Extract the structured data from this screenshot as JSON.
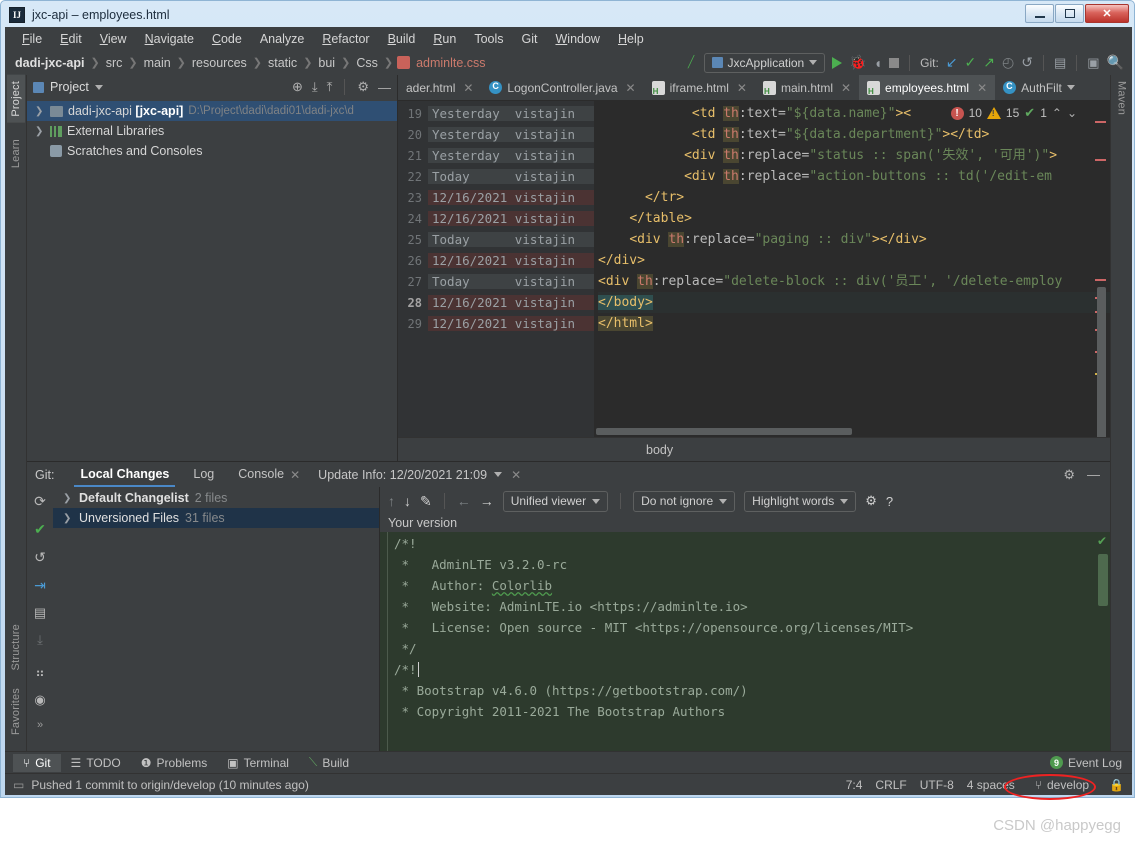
{
  "window": {
    "title": "jxc-api – employees.html",
    "app_icon": "IJ",
    "controls": {
      "minimize": "minimize-icon",
      "maximize": "maximize-icon",
      "close": "✕"
    }
  },
  "menu": {
    "items": [
      "File",
      "Edit",
      "View",
      "Navigate",
      "Code",
      "Analyze",
      "Refactor",
      "Build",
      "Run",
      "Tools",
      "Git",
      "Window",
      "Help"
    ]
  },
  "navbar": {
    "crumbs": [
      "dadi-jxc-api",
      "src",
      "main",
      "resources",
      "static",
      "bui",
      "Css",
      "adminlte.css"
    ],
    "run_config": "JxcApplication",
    "git_label": "Git:"
  },
  "project": {
    "title": "Project",
    "tree": [
      {
        "arrow": ">",
        "name": "dadi-jxc-api",
        "module": "[jxc-api]",
        "path": "D:\\Project\\dadi\\dadi01\\dadi-jxc\\d",
        "selected": true
      },
      {
        "arrow": ">",
        "name": "External Libraries",
        "module": "",
        "path": "",
        "selected": false
      },
      {
        "arrow": "",
        "name": "Scratches and Consoles",
        "module": "",
        "path": "",
        "selected": false
      }
    ]
  },
  "editor": {
    "tabs": [
      {
        "label": "ader.html",
        "type": "html",
        "active": false
      },
      {
        "label": "LogonController.java",
        "type": "java",
        "active": false
      },
      {
        "label": "iframe.html",
        "type": "html",
        "active": false
      },
      {
        "label": "main.html",
        "type": "html",
        "active": false
      },
      {
        "label": "employees.html",
        "type": "html",
        "active": true
      },
      {
        "label": "AuthFilt",
        "type": "java",
        "active": false
      }
    ],
    "annotate": [
      {
        "num": "19",
        "date": "Yesterday",
        "author": "vistajin",
        "shade": "gray"
      },
      {
        "num": "20",
        "date": "Yesterday",
        "author": "vistajin",
        "shade": "gray"
      },
      {
        "num": "21",
        "date": "Yesterday",
        "author": "vistajin",
        "shade": "gray"
      },
      {
        "num": "22",
        "date": "Today",
        "author": "vistajin",
        "shade": "gray"
      },
      {
        "num": "23",
        "date": "12/16/2021",
        "author": "vistajin",
        "shade": "red"
      },
      {
        "num": "24",
        "date": "12/16/2021",
        "author": "vistajin",
        "shade": "red"
      },
      {
        "num": "25",
        "date": "Today",
        "author": "vistajin",
        "shade": "gray"
      },
      {
        "num": "26",
        "date": "12/16/2021",
        "author": "vistajin",
        "shade": "red"
      },
      {
        "num": "27",
        "date": "Today",
        "author": "vistajin",
        "shade": "gray"
      },
      {
        "num": "28",
        "date": "12/16/2021",
        "author": "vistajin",
        "shade": "red",
        "current": true
      },
      {
        "num": "29",
        "date": "12/16/2021",
        "author": "vistajin",
        "shade": "red"
      }
    ],
    "code_lines": [
      "            <td th:text=\"${data.name}\"><",
      "            <td th:text=\"${data.department}\"></td>",
      "           <div th:replace=\"status :: span('失效', '可用')\">",
      "           <div th:replace=\"action-buttons :: td('/edit-em",
      "      </tr>",
      "    </table>",
      "    <div th:replace=\"paging :: div\"></div>",
      "</div>",
      "<div th:replace=\"delete-block :: div('员工', '/delete-employ",
      "</body>",
      "</html>"
    ],
    "inspection": {
      "errors": "10",
      "warnings": "15",
      "checks": "1"
    },
    "breadcrumb": "body"
  },
  "git_tool": {
    "label": "Git:",
    "tabs": [
      "Local Changes",
      "Log",
      "Console"
    ],
    "active_tab": "Local Changes",
    "update_info": "Update Info: 12/20/2021 21:09",
    "changelists": [
      {
        "name": "Default Changelist",
        "count": "2 files",
        "selected": false
      },
      {
        "name": "Unversioned Files",
        "count": "31 files",
        "selected": true
      }
    ],
    "diff_toolbar": {
      "viewer": "Unified viewer",
      "ignore": "Do not ignore",
      "highlight": "Highlight words",
      "help": "?"
    },
    "your_version": "Your version",
    "diff_lines": [
      "/*!",
      " *   AdminLTE v3.2.0-rc",
      " *   Author: Colorlib",
      " *   Website: AdminLTE.io <https://adminlte.io>",
      " *   License: Open source - MIT <https://opensource.org/licenses/MIT>",
      " */",
      "/*!",
      " * Bootstrap v4.6.0 (https://getbootstrap.com/)",
      " * Copyright 2011-2021 The Bootstrap Authors"
    ]
  },
  "bottom_tabs": [
    {
      "label": "Git",
      "icon": "branch-icon",
      "active": true
    },
    {
      "label": "TODO",
      "icon": "list-icon",
      "active": false
    },
    {
      "label": "Problems",
      "icon": "error-icon",
      "active": false
    },
    {
      "label": "Terminal",
      "icon": "terminal-icon",
      "active": false
    },
    {
      "label": "Build",
      "icon": "hammer-icon",
      "active": false
    }
  ],
  "event_log": {
    "label": "Event Log",
    "count": "9"
  },
  "status": {
    "message": "Pushed 1 commit to origin/develop (10 minutes ago)",
    "caret": "7:4",
    "line_sep": "CRLF",
    "encoding": "UTF-8",
    "indent": "4 spaces",
    "branch": "develop"
  },
  "sidebars": {
    "left": [
      "Project",
      "Learn",
      "Structure",
      "Favorites"
    ],
    "right": [
      "Maven"
    ]
  },
  "watermark": "CSDN @happyegg",
  "colors": {
    "accent_blue": "#4a88c7",
    "annotation_red": "#ee2222",
    "ide_bg": "#3c3f41",
    "editor_bg": "#2b2b2b",
    "diff_bg": "#2d3a2d"
  }
}
